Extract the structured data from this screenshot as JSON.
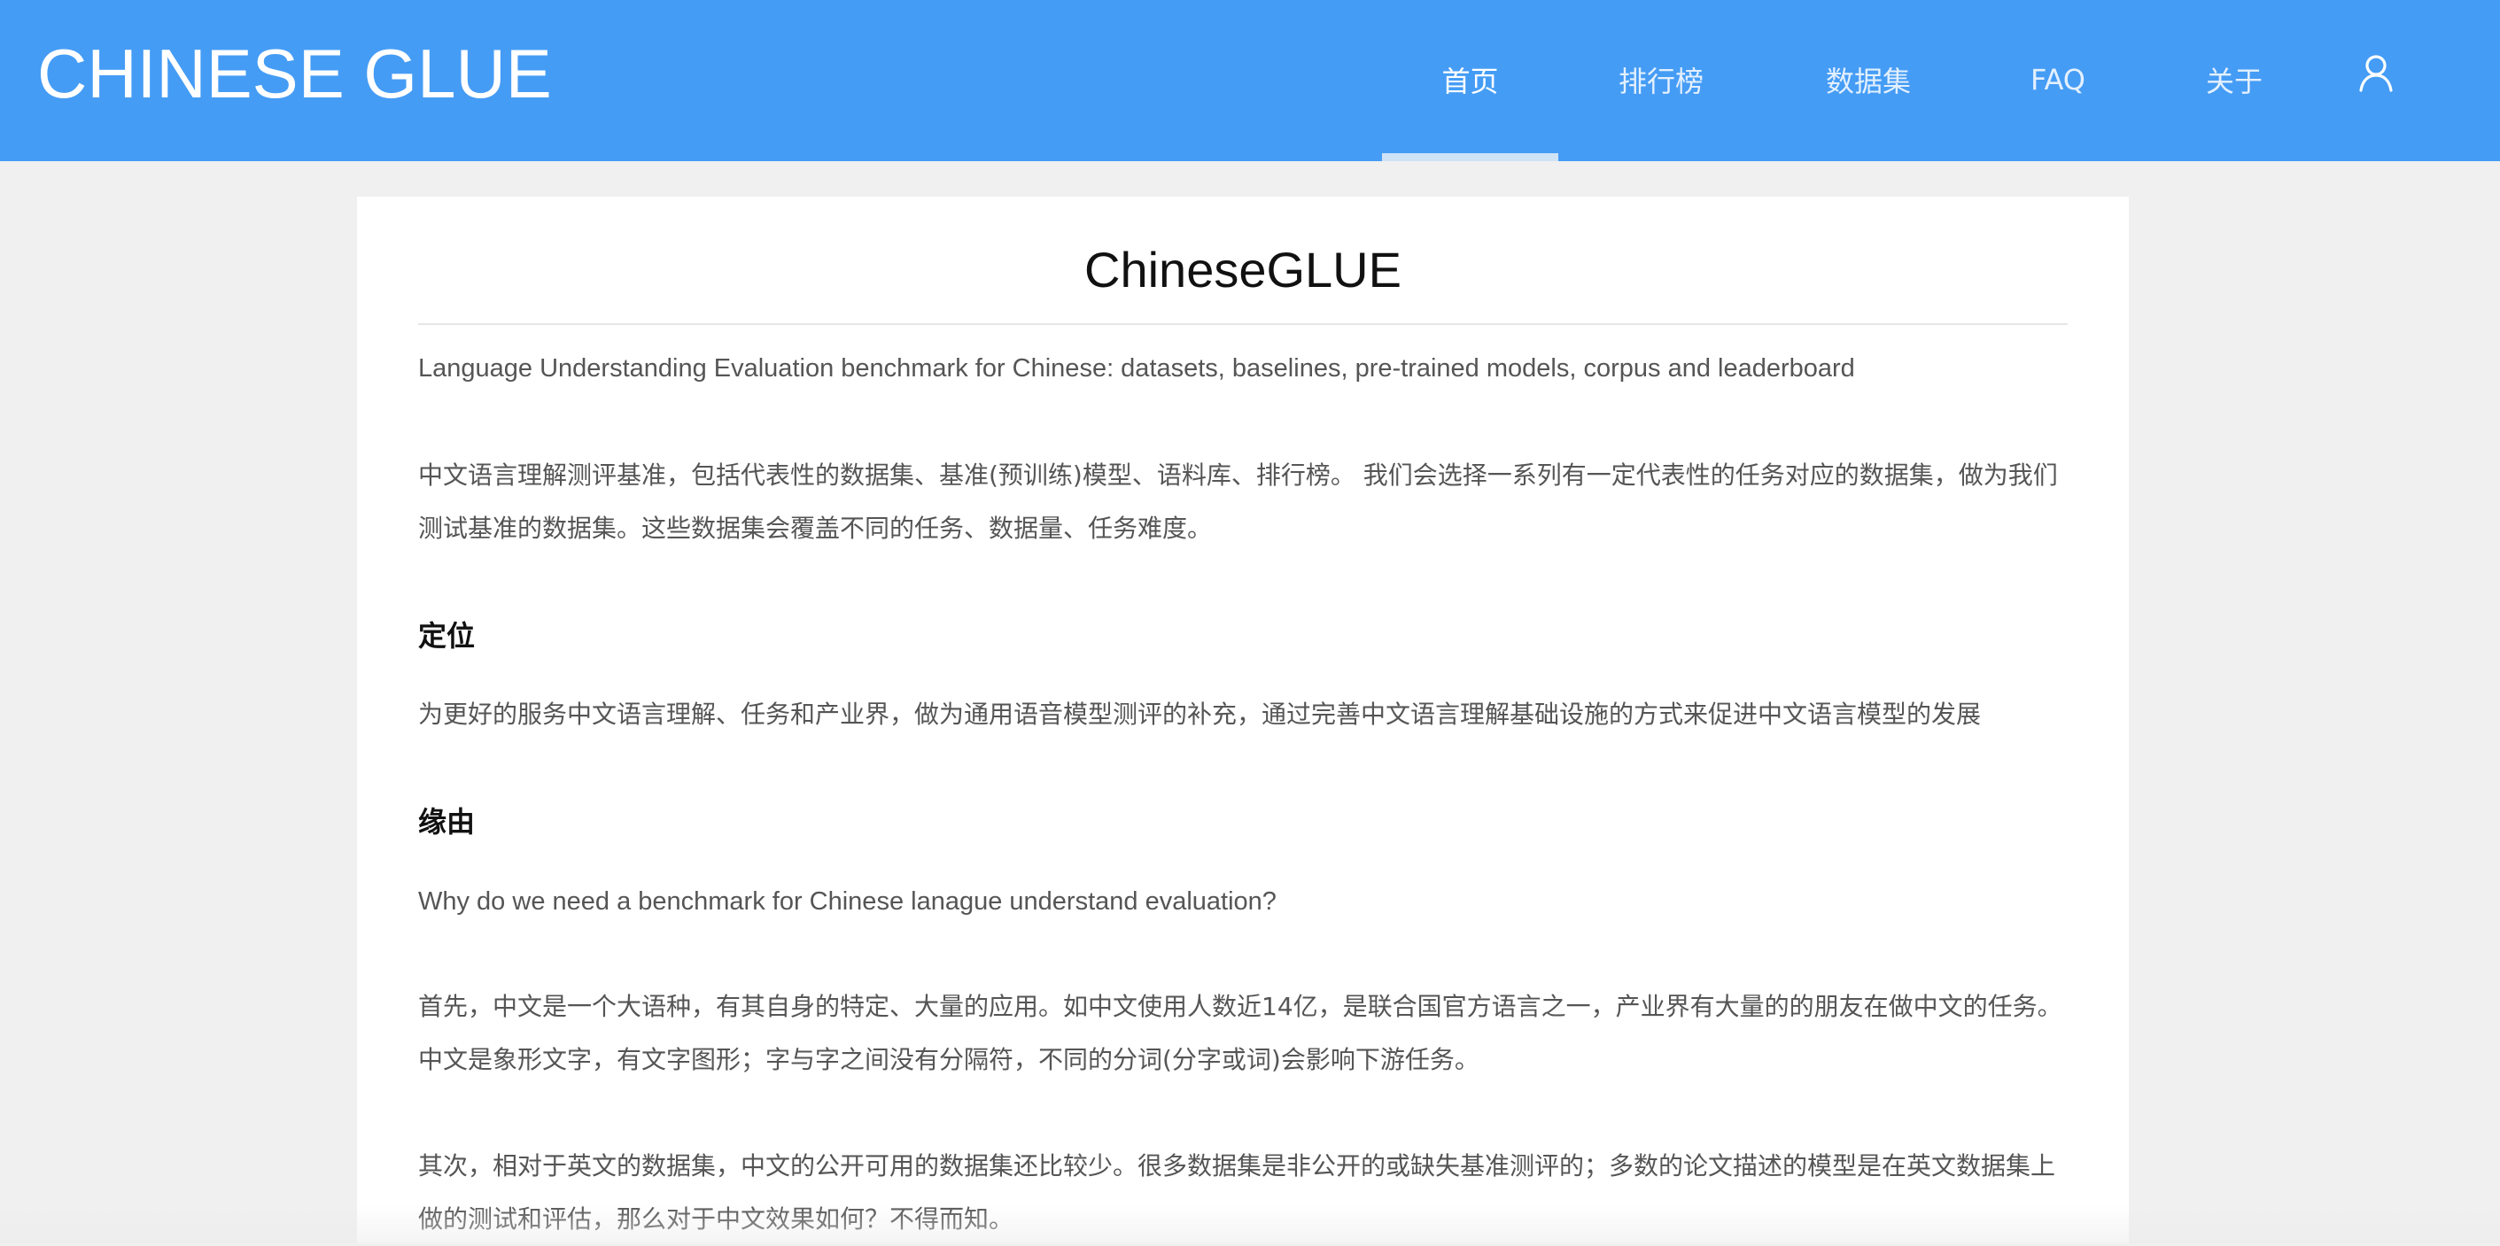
{
  "header": {
    "brand": "CHINESE GLUE",
    "nav": [
      {
        "label": "首页",
        "active": true
      },
      {
        "label": "排行榜",
        "active": false
      },
      {
        "label": "数据集",
        "active": false
      },
      {
        "label": "FAQ",
        "active": false
      },
      {
        "label": "关于",
        "active": false
      }
    ],
    "user_icon": "user-icon"
  },
  "colors": {
    "header_bg": "#459cf5",
    "page_bg": "#f0f0f0",
    "card_bg": "#ffffff",
    "body_text": "#555555",
    "heading_text": "#111111"
  },
  "main": {
    "title": "ChineseGLUE",
    "tagline": "Language Understanding Evaluation benchmark for Chinese: datasets, baselines, pre-trained models, corpus and leaderboard",
    "intro": [
      "中文语言理解测评基准，包括代表性的数据集、基准(预训练)模型、语料库、排行榜。 我们会选择一系列有一定代表性的任务对应的数据集，做为我们",
      "测试基准的数据集。这些数据集会覆盖不同的任务、数据量、任务难度。"
    ],
    "positioning": {
      "heading": "定位",
      "text": "为更好的服务中文语言理解、任务和产业界，做为通用语音模型测评的补充，通过完善中文语言理解基础设施的方式来促进中文语言模型的发展"
    },
    "reason": {
      "heading": "缘由",
      "question": "Why do we need a benchmark for Chinese lanague understand evaluation?",
      "first": [
        "首先，中文是一个大语种，有其自身的特定、大量的应用。如中文使用人数近14亿，是联合国官方语言之一，产业界有大量的的朋友在做中文的任务。",
        "中文是象形文字，有文字图形；字与字之间没有分隔符，不同的分词(分字或词)会影响下游任务。"
      ],
      "second": [
        "其次，相对于英文的数据集，中文的公开可用的数据集还比较少。很多数据集是非公开的或缺失基准测评的；多数的论文描述的模型是在英文数据集上",
        "做的测试和评估，那么对于中文效果如何？不得而知。"
      ]
    }
  }
}
